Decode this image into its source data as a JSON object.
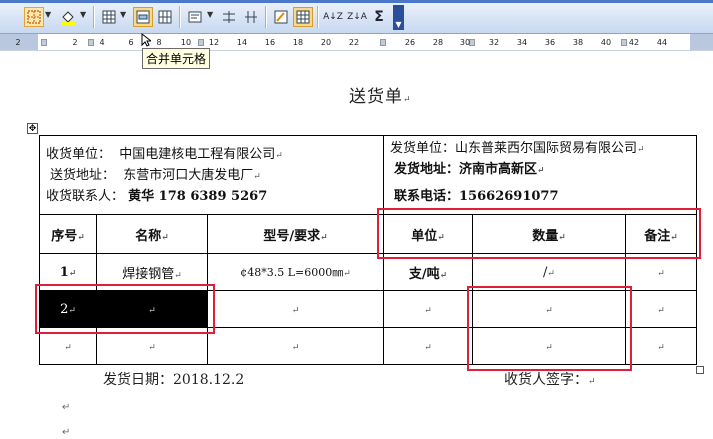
{
  "toolbar": {
    "buttons": [
      "border-icon",
      "fill-color-icon",
      "table-grid-icon",
      "merge-cells-icon",
      "split-cells-icon",
      "align-icon",
      "distribute-rows-icon",
      "distribute-cols-icon",
      "autoformat-icon",
      "show-gridlines-icon",
      "sort-asc-icon",
      "sort-desc-icon",
      "autosum-icon"
    ],
    "sort_asc_label": "A↓Z",
    "sort_desc_label": "Z↓A",
    "sum_label": "Σ",
    "tooltip": "合并单元格",
    "accent": "#fbd98b"
  },
  "ruler": {
    "ticks": [
      "2",
      "2",
      "4",
      "6",
      "8",
      "10",
      "12",
      "14",
      "16",
      "18",
      "20",
      "22",
      "26",
      "28",
      "30",
      "32",
      "34",
      "36",
      "38",
      "40",
      "42",
      "44"
    ]
  },
  "document": {
    "title": "送货单",
    "receiver": {
      "unit_label": "收货单位：",
      "unit_value": "中国电建核电工程有限公司",
      "address_label": "送货地址：",
      "address_value": "东营市河口大唐发电厂",
      "contact_label": "收货联系人：",
      "contact_value": "黄华 178 6389 5267"
    },
    "sender": {
      "unit_label": "发货单位：",
      "unit_value": "山东普莱西尔国际贸易有限公司",
      "address_label": "发货地址：",
      "address_value": "济南市高新区",
      "phone_label": "联系电话：",
      "phone_value": "15662691077"
    },
    "columns": [
      "序号",
      "名称",
      "型号/要求",
      "单位",
      "数量",
      "备注"
    ],
    "rows": [
      {
        "no": "1",
        "name": "焊接钢管",
        "model": "¢48*3.5 L=6000㎜",
        "unit": "支/吨",
        "qty": "/",
        "note": ""
      },
      {
        "no": "2",
        "name": "",
        "model": "",
        "unit": "",
        "qty": "",
        "note": ""
      },
      {
        "no": "",
        "name": "",
        "model": "",
        "unit": "",
        "qty": "",
        "note": ""
      }
    ],
    "ship_date_label": "发货日期：",
    "ship_date_value": "2018.12.2",
    "signature_label": "收货人签字：",
    "para_mark": "↵"
  },
  "highlight_color": "#e01e37"
}
